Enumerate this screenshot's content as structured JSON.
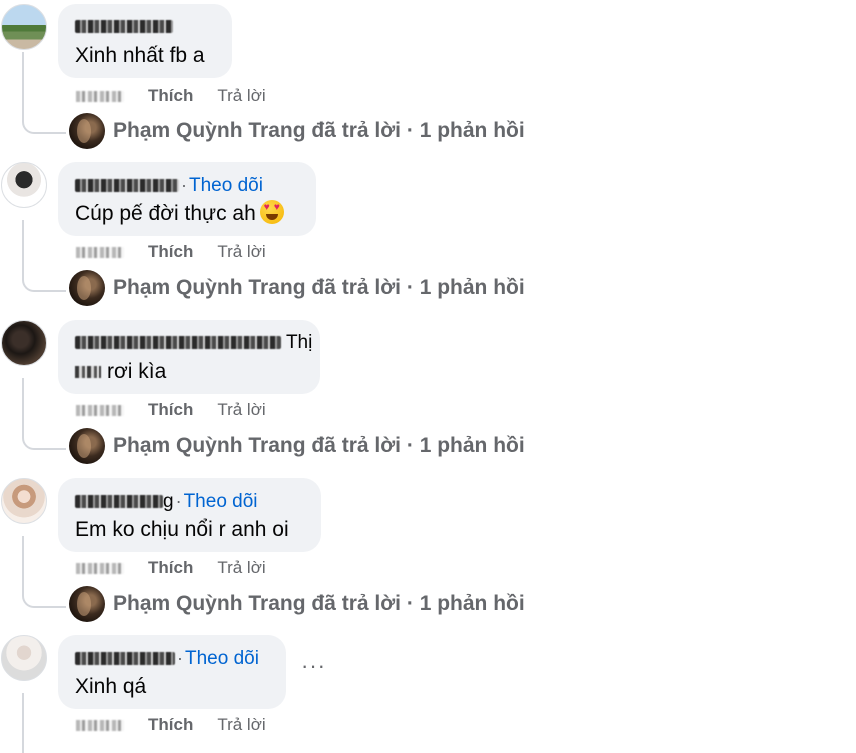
{
  "comments": [
    {
      "follow": "",
      "text": "Xinh nhất fb a",
      "time": "",
      "like": "Thích",
      "reply": "Trả lời",
      "reply_summary": {
        "author": "Phạm Quỳnh Trang",
        "action": "đã trả lời",
        "sep": "·",
        "count": "1 phản hồi"
      }
    },
    {
      "follow": "Theo dõi",
      "text": "Cúp pế đời thực ah",
      "emoji": "heart-eyes-emoji",
      "like": "Thích",
      "reply": "Trả lời",
      "reply_summary": {
        "author": "Phạm Quỳnh Trang",
        "action": "đã trả lời",
        "sep": "·",
        "count": "1 phản hồi"
      }
    },
    {
      "follow": "",
      "name_tail": "Thị",
      "text": "rơi kìa",
      "like": "Thích",
      "reply": "Trả lời",
      "reply_summary": {
        "author": "Phạm Quỳnh Trang",
        "action": "đã trả lời",
        "sep": "·",
        "count": "1 phản hồi"
      }
    },
    {
      "follow": "Theo dõi",
      "name_tail": "g",
      "text": "Em ko chịu nổi r anh oi",
      "like": "Thích",
      "reply": "Trả lời",
      "reply_summary": {
        "author": "Phạm Quỳnh Trang",
        "action": "đã trả lời",
        "sep": "·",
        "count": "1 phản hồi"
      }
    },
    {
      "follow": "Theo dõi",
      "text": "Xinh qá",
      "like": "Thích",
      "reply": "Trả lời",
      "more": "···"
    }
  ],
  "dot": "·",
  "colors": {
    "bubble": "#f0f2f5",
    "link": "#0064d1",
    "secondary": "#65676b"
  }
}
